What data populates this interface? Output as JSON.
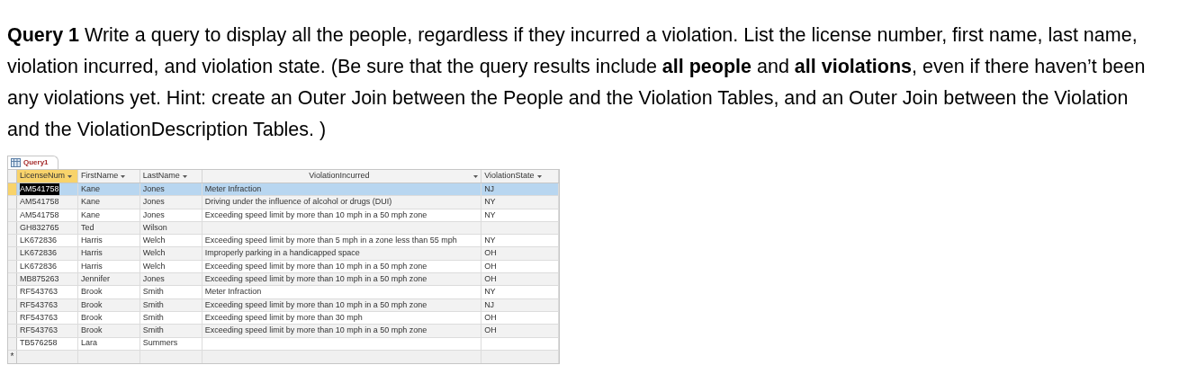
{
  "instructions": "**Query 1**  Write a query to display all the people, regardless if they incurred a violation. List the license number, first name, last name, violation incurred, and violation state. (Be sure that the query results include **all people** and **all violations**, even if there haven’t been any violations yet. Hint: create an Outer Join between the People and the Violation Tables, and an Outer Join between the Violation and the ViolationDescription Tables. )",
  "datasheet": {
    "tab": "Query1",
    "columns": [
      {
        "label": "LicenseNum",
        "selected": true
      },
      {
        "label": "FirstName",
        "selected": false
      },
      {
        "label": "LastName",
        "selected": false
      },
      {
        "label": "ViolationIncurred",
        "selected": false
      },
      {
        "label": "ViolationState",
        "selected": false
      }
    ],
    "rows": [
      {
        "selected": true,
        "cells": [
          "AM541758",
          "Kane",
          "Jones",
          "Meter Infraction",
          "NJ"
        ]
      },
      {
        "selected": false,
        "cells": [
          "AM541758",
          "Kane",
          "Jones",
          "Driving under the influence of alcohol or drugs  (DUI)",
          "NY"
        ]
      },
      {
        "selected": false,
        "cells": [
          "AM541758",
          "Kane",
          "Jones",
          "Exceeding speed limit by more than 10 mph in a 50 mph zone",
          "NY"
        ]
      },
      {
        "selected": false,
        "cells": [
          "GH832765",
          "Ted",
          "Wilson",
          "",
          ""
        ]
      },
      {
        "selected": false,
        "cells": [
          "LK672836",
          "Harris",
          "Welch",
          "Exceeding speed limit by more than 5 mph in a zone less than 55 mph",
          "NY"
        ]
      },
      {
        "selected": false,
        "cells": [
          "LK672836",
          "Harris",
          "Welch",
          "Improperly parking in a handicapped space",
          "OH"
        ]
      },
      {
        "selected": false,
        "cells": [
          "LK672836",
          "Harris",
          "Welch",
          "Exceeding speed limit by more than 10 mph in a 50 mph zone",
          "OH"
        ]
      },
      {
        "selected": false,
        "cells": [
          "MB875263",
          "Jennifer",
          "Jones",
          "Exceeding speed limit by more than 10 mph in a 50 mph zone",
          "OH"
        ]
      },
      {
        "selected": false,
        "cells": [
          "RF543763",
          "Brook",
          "Smith",
          "Meter Infraction",
          "NY"
        ]
      },
      {
        "selected": false,
        "cells": [
          "RF543763",
          "Brook",
          "Smith",
          "Exceeding speed limit by more than 10 mph in a 50 mph zone",
          "NJ"
        ]
      },
      {
        "selected": false,
        "cells": [
          "RF543763",
          "Brook",
          "Smith",
          "Exceeding speed limit by more than 30 mph",
          "OH"
        ]
      },
      {
        "selected": false,
        "cells": [
          "RF543763",
          "Brook",
          "Smith",
          "Exceeding speed limit by more than 10 mph in a 50 mph zone",
          "OH"
        ]
      },
      {
        "selected": false,
        "cells": [
          "TB576258",
          "Lara",
          "Summers",
          "",
          ""
        ]
      }
    ],
    "new_row_marker": "*"
  }
}
